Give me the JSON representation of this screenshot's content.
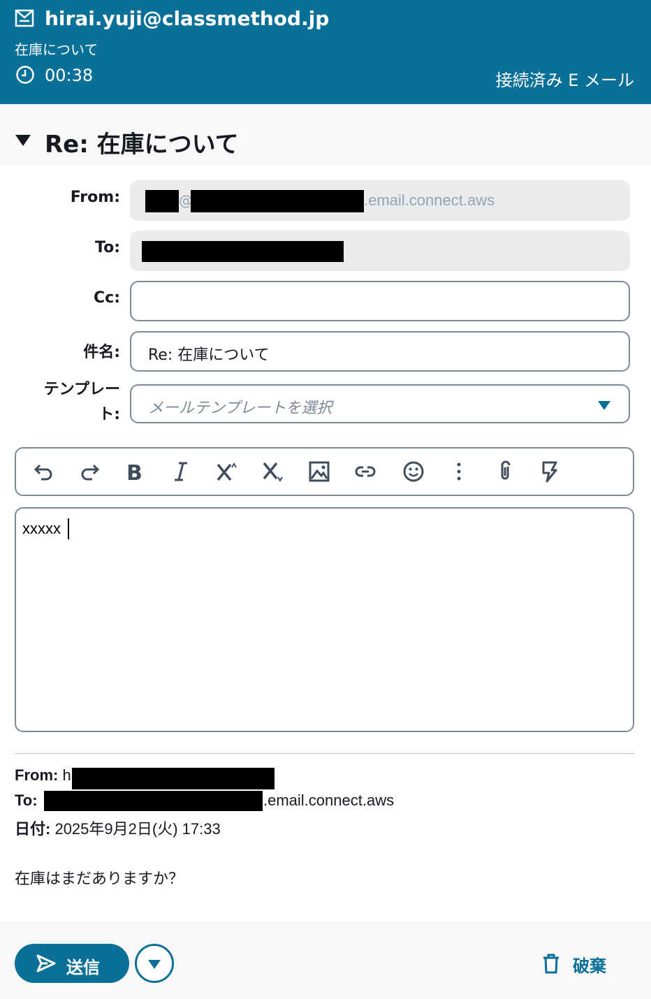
{
  "header": {
    "email": "hirai.yuji@classmethod.jp",
    "subject": "在庫について",
    "timer": "00:38",
    "status": "接続済み E メール",
    "bg_color": "#0a7098"
  },
  "compose": {
    "title": "Re: 在庫について",
    "from_label": "From:",
    "from_suffix": ".email.connect.aws",
    "from_at": "@",
    "to_label": "To:",
    "cc_label": "Cc:",
    "cc_value": "",
    "subject_label": "件名:",
    "subject_value": "Re: 在庫について",
    "template_label": "テンプレート:",
    "template_placeholder": "メールテンプレートを選択"
  },
  "toolbar": {
    "items": [
      "undo-icon",
      "redo-icon",
      "bold-icon",
      "italic-icon",
      "superscript-icon",
      "subscript-icon",
      "image-icon",
      "link-icon",
      "emoji-icon",
      "more-vertical-icon",
      "attachment-icon",
      "quick-response-icon"
    ]
  },
  "editor": {
    "body": "xxxxx"
  },
  "quoted": {
    "from_label": "From:",
    "from_value": "h",
    "to_label": "To:",
    "to_suffix": ".email.connect.aws",
    "date_label": "日付:",
    "date_value": "2025年9月2日(火) 17:33",
    "body": "在庫はまだありますか？"
  },
  "footer": {
    "send_label": "送信",
    "discard_label": "破棄",
    "accent_color": "#0a7098"
  }
}
